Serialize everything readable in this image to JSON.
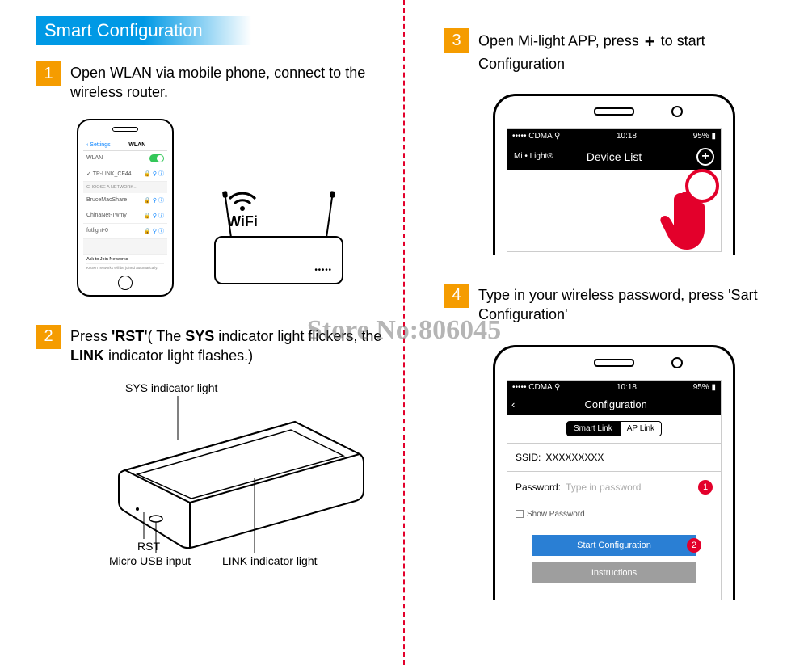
{
  "header": {
    "title": "Smart Configuration"
  },
  "watermark": "Store No:806045",
  "step1": {
    "num": "1",
    "text": "Open WLAN via mobile phone, connect to the wireless router.",
    "phone": {
      "nav_back": "‹ Settings",
      "nav_title": "WLAN",
      "wlan_label": "WLAN",
      "connected": "TP-LINK_CF44",
      "choose_hdr": "CHOOSE A NETWORK…",
      "nets": [
        "BruceMacShare",
        "ChinaNet-Twmy",
        "futlight-0"
      ],
      "ask": "Ask to Join Networks"
    },
    "wifi_label": "WiFi"
  },
  "step2": {
    "num": "2",
    "text_pre": "Press ",
    "rst": "'RST'",
    "text_mid": "( The ",
    "sys": "SYS",
    "text_mid2": " indicator light flickers, the ",
    "link": "LINK",
    "text_end": " indicator light flashes.)",
    "labels": {
      "sys": "SYS indicator light",
      "rst": "RST",
      "usb": "Micro USB input",
      "link": "LINK indicator light"
    }
  },
  "step3": {
    "num": "3",
    "text_pre": "Open Mi-light APP, press ",
    "plus": "+",
    "text_post": " to start Configuration",
    "status": {
      "left": "••••• CDMA ⚲",
      "mid": "10:18",
      "right": "95% ▮"
    },
    "nav": {
      "brand": "Mi • Light®",
      "title": "Device List"
    }
  },
  "step4": {
    "num": "4",
    "text": "Type in your wireless password, press 'Sart Configuration'",
    "status": {
      "left": "••••• CDMA ⚲",
      "mid": "10:18",
      "right": "95% ▮"
    },
    "cfg_title": "Configuration",
    "tabs": {
      "a": "Smart Link",
      "b": "AP Link"
    },
    "ssid_k": "SSID:",
    "ssid_v": "XXXXXXXXX",
    "pwd_k": "Password:",
    "pwd_ph": "Type in password",
    "show_pwd": "Show Password",
    "btn_start": "Start Configuration",
    "btn_instr": "Instructions",
    "b1": "1",
    "b2": "2"
  }
}
